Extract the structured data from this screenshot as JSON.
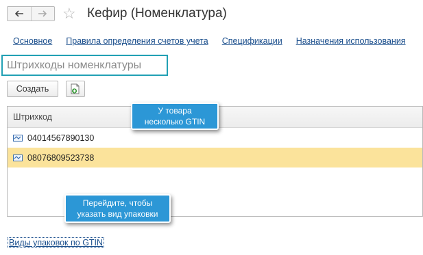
{
  "header": {
    "title": "Кефир (Номенклатура)"
  },
  "tabs": [
    {
      "label": "Основное"
    },
    {
      "label": "Правила определения счетов учета"
    },
    {
      "label": "Спецификации"
    },
    {
      "label": "Назначения использования"
    }
  ],
  "section": {
    "heading": "Штрихкоды номенклатуры"
  },
  "toolbar": {
    "create_label": "Создать"
  },
  "table": {
    "columns": [
      "Штрихкод"
    ],
    "rows": [
      {
        "barcode": "04014567890130"
      },
      {
        "barcode": "08076809523738"
      }
    ]
  },
  "tooltips": {
    "gtin_note": "У товара\nнесколько GTIN",
    "package_hint": "Перейдите, чтобы\nуказать вид упаковки"
  },
  "footer": {
    "gtin_link": "Виды упаковок по GTIN"
  },
  "colors": {
    "accent_border": "#21a0b4",
    "selected_row": "#fbe39b",
    "tooltip_bg": "#2c97d6",
    "link": "#1a4e8c"
  }
}
